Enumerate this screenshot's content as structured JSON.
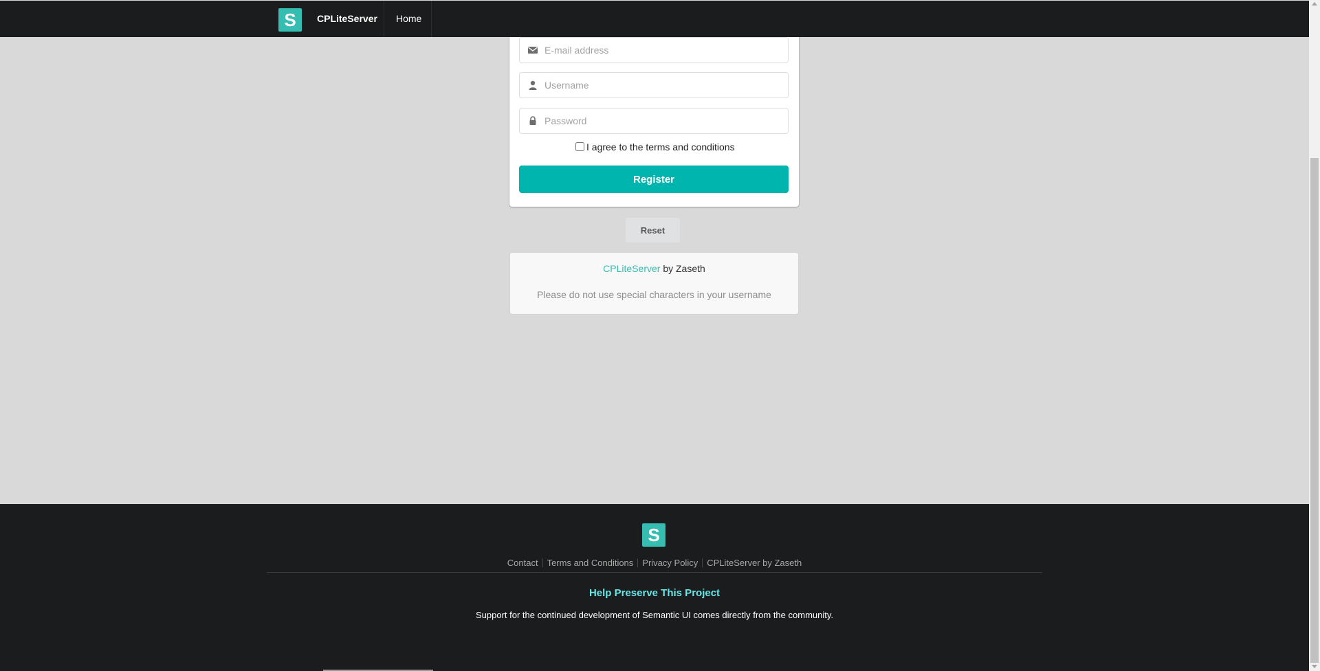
{
  "topbar": {
    "logo_letter": "S",
    "brand": "CPLiteServer",
    "home": "Home"
  },
  "form": {
    "email_placeholder": "E-mail address",
    "username_placeholder": "Username",
    "password_placeholder": "Password",
    "agree_label": "I agree to the terms and conditions",
    "register_label": "Register",
    "reset_label": "Reset"
  },
  "message": {
    "link_text": "CPLiteServer",
    "by_text": " by Zaseth",
    "note": "Please do not use special characters in your username"
  },
  "footer": {
    "logo_letter": "S",
    "links": [
      "Contact",
      "Terms and Conditions",
      "Privacy Policy",
      "CPLiteServer by Zaseth"
    ],
    "heading": "Help Preserve This Project",
    "text": "Support for the continued development of Semantic UI comes directly from the community."
  },
  "colors": {
    "accent": "#00b5ad",
    "logo": "#35bdb2",
    "dark": "#1b1c1d",
    "page_bg": "#d9d9d9",
    "footer_heading": "#66e6e6"
  },
  "icons": {
    "email": "envelope-icon",
    "username": "user-icon",
    "password": "lock-icon"
  }
}
